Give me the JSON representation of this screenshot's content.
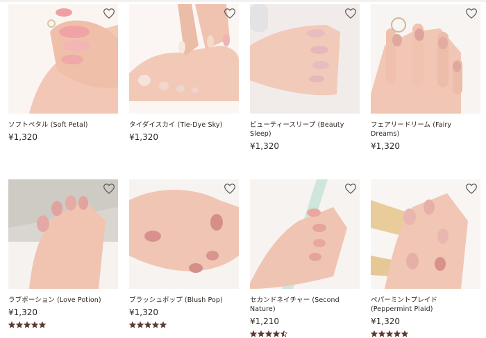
{
  "products": [
    {
      "name": "ソフトペタル (Soft Petal)",
      "price": "¥1,320",
      "rating": null
    },
    {
      "name": "タイダイスカイ (Tie-Dye Sky)",
      "price": "¥1,320",
      "rating": null
    },
    {
      "name": "ビューティースリープ (Beauty Sleep)",
      "price": "¥1,320",
      "rating": null
    },
    {
      "name": "フェアリードリーム (Fairy Dreams)",
      "price": "¥1,320",
      "rating": null
    },
    {
      "name": "ラブポーション (Love Potion)",
      "price": "¥1,320",
      "rating": 5
    },
    {
      "name": "ブラッシュポップ (Blush Pop)",
      "price": "¥1,320",
      "rating": 5
    },
    {
      "name": "セカンドネイチャー (Second Nature)",
      "price": "¥1,210",
      "rating": 4.5
    },
    {
      "name": "ペパーミントプレイド (Peppermint Plaid)",
      "price": "¥1,320",
      "rating": 5
    }
  ],
  "icons": {
    "wishlist": "heart-outline-icon",
    "rating": "star-icon"
  },
  "colors": {
    "text": "#2b2622",
    "star": "#5a3a32",
    "heart": "#555555"
  }
}
